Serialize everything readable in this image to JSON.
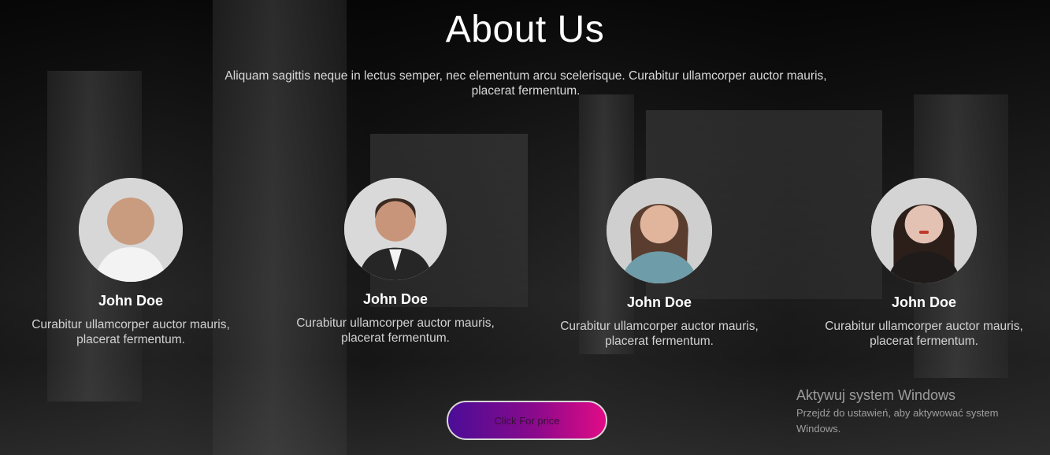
{
  "page": {
    "title": "About Us",
    "subtitle": "Aliquam sagittis neque in lectus semper, nec elementum arcu scelerisque. Curabitur ullamcorper auctor mauris, placerat fermentum.",
    "button_label": "Click For price"
  },
  "team": [
    {
      "name": "John Doe",
      "description": "Curabitur ullamcorper auctor mauris, placerat fermentum."
    },
    {
      "name": "John Doe",
      "description": "Curabitur ullamcorper auctor mauris, placerat fermentum."
    },
    {
      "name": "John Doe",
      "description": "Curabitur ullamcorper auctor mauris, placerat fermentum."
    },
    {
      "name": "John Doe",
      "description": "Curabitur ullamcorper auctor mauris, placerat fermentum."
    }
  ],
  "watermark": {
    "title": "Aktywuj system Windows",
    "subtitle": "Przejdź do ustawień, aby aktywować system Windows."
  },
  "colors": {
    "button_gradient_start": "#4b0d97",
    "button_gradient_end": "#e10b86"
  }
}
